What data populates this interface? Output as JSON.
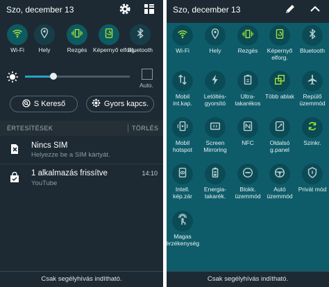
{
  "left": {
    "status_bar": {
      "date": "Szo, december 13",
      "icons": [
        "gear-icon",
        "grid-edit-icon"
      ]
    },
    "quick_toggles": [
      {
        "label": "Wi-Fi",
        "icon": "wifi-icon",
        "active": true
      },
      {
        "label": "Hely",
        "icon": "location-icon",
        "active": false
      },
      {
        "label": "Rezgés",
        "icon": "vibrate-icon",
        "active": true
      },
      {
        "label": "Képernyő elforg.",
        "icon": "rotate-icon",
        "active": true
      },
      {
        "label": "Bluetooth",
        "icon": "bluetooth-icon",
        "active": false
      }
    ],
    "brightness": {
      "level": 0.27,
      "auto_label": "Auto."
    },
    "buttons": {
      "search": "S Kereső",
      "quick_connect": "Gyors kapcs."
    },
    "section": {
      "notifications": "ÉRTESÍTÉSEK",
      "clear": "TÖRLÉS"
    },
    "notifications": [
      {
        "title": "Nincs SIM",
        "subtitle": "Helyezze be a SIM kártyát.",
        "time": "",
        "icon": "no-sim-icon"
      },
      {
        "title": "1 alkalmazás frissítve",
        "subtitle": "YouTube",
        "time": "14:10",
        "icon": "shopping-bag-icon"
      }
    ],
    "footer": "Csak segélyhívás indítható."
  },
  "right": {
    "status_bar": {
      "date": "Szo, december 13",
      "icons": [
        "pencil-icon"
      ]
    },
    "toggles": [
      {
        "label": "Wi-Fi",
        "icon": "wifi-icon",
        "active": true
      },
      {
        "label": "Hely",
        "icon": "location-icon",
        "active": false
      },
      {
        "label": "Rezgés",
        "icon": "vibrate-icon",
        "active": true
      },
      {
        "label": "Képernyő elforg.",
        "icon": "rotate-icon",
        "active": true
      },
      {
        "label": "Bluetooth",
        "icon": "bluetooth-icon",
        "active": false
      },
      {
        "label": "Mobil int.kap.",
        "icon": "mobile-data-icon",
        "active": false
      },
      {
        "label": "Letöltés-gyorsító",
        "icon": "download-booster-icon",
        "active": false
      },
      {
        "label": "Ultra-takarékos",
        "icon": "ultra-saving-icon",
        "active": false
      },
      {
        "label": "Több ablak",
        "icon": "multi-window-icon",
        "active": true
      },
      {
        "label": "Repülő üzemmód",
        "icon": "airplane-icon",
        "active": false
      },
      {
        "label": "Mobil hotspot",
        "icon": "hotspot-icon",
        "active": false
      },
      {
        "label": "Screen Mirroring",
        "icon": "screen-mirroring-icon",
        "active": false
      },
      {
        "label": "NFC",
        "icon": "nfc-icon",
        "active": false
      },
      {
        "label": "Oldalsó g.panel",
        "icon": "side-panel-icon",
        "active": false
      },
      {
        "label": "Szinkr.",
        "icon": "sync-icon",
        "active": true
      },
      {
        "label": "Intell. kép.zár",
        "icon": "smart-stay-icon",
        "active": false
      },
      {
        "label": "Energia-takarék.",
        "icon": "power-saving-icon",
        "active": false
      },
      {
        "label": "Blokk. üzemmód",
        "icon": "blocking-mode-icon",
        "active": false
      },
      {
        "label": "Autó üzemmód",
        "icon": "car-mode-icon",
        "active": false
      },
      {
        "label": "Privát mód",
        "icon": "private-mode-icon",
        "active": false
      },
      {
        "label": "Magas érzékenység",
        "icon": "touch-sensitivity-icon",
        "active": false
      }
    ],
    "footer": "Csak segélyhívás indítható."
  },
  "colors": {
    "accent": "#2aa2c8",
    "active_icon": "#9ee03a",
    "inactive_icon": "#bcd0d4",
    "left_bg": "#1d2a33",
    "right_bg": "#0e5c6a"
  }
}
